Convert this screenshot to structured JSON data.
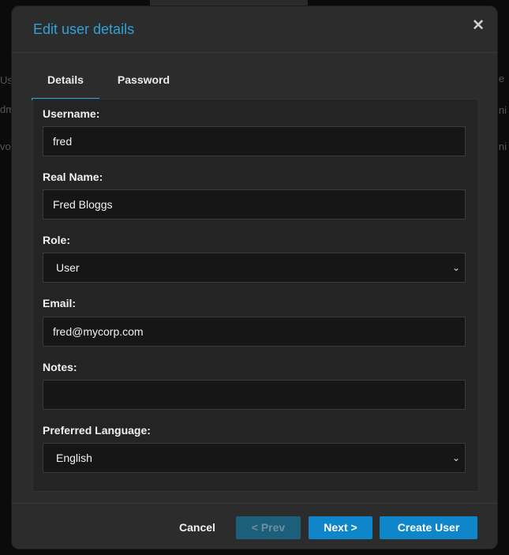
{
  "background": {
    "left_fragments": [
      "Use",
      "dm",
      "vor"
    ],
    "right_fragments": [
      "le",
      "ini",
      "ini"
    ]
  },
  "modal": {
    "title": "Edit user details",
    "close_glyph": "✕"
  },
  "tabs": [
    {
      "label": "Details",
      "active": true
    },
    {
      "label": "Password",
      "active": false
    }
  ],
  "form": {
    "username": {
      "label": "Username:",
      "value": "fred"
    },
    "real_name": {
      "label": "Real Name:",
      "value": "Fred Bloggs"
    },
    "role": {
      "label": "Role:",
      "selected": "User",
      "chevron": "⌄"
    },
    "email": {
      "label": "Email:",
      "value": "fred@mycorp.com"
    },
    "notes": {
      "label": "Notes:",
      "value": ""
    },
    "preferred_language": {
      "label": "Preferred Language:",
      "selected": "English",
      "chevron": "⌄"
    }
  },
  "footer": {
    "cancel_label": "Cancel",
    "prev_label": "< Prev",
    "next_label": "Next >",
    "create_label": "Create User"
  },
  "colors": {
    "accent": "#2fa3d8",
    "button_primary": "#0e86c9",
    "button_disabled": "#1b5f7b"
  }
}
